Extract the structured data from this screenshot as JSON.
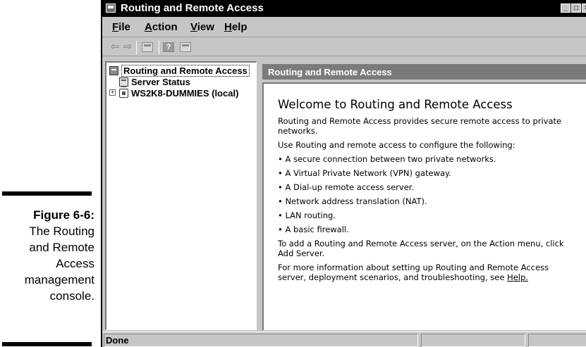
{
  "caption": {
    "figure_number": "Figure 6-6:",
    "text": "The Routing\nand Remote\nAccess\nmanagement\nconsole."
  },
  "window": {
    "title": "Routing and Remote Access",
    "controls": {
      "minimize": "_",
      "maximize": "□",
      "close": "×"
    }
  },
  "menu": [
    {
      "label": "File",
      "access_key": "F",
      "rest": "ile"
    },
    {
      "label": "Action",
      "access_key": "A",
      "rest": "ction"
    },
    {
      "label": "View",
      "access_key": "V",
      "rest": "iew"
    },
    {
      "label": "Help",
      "access_key": "H",
      "rest": "elp"
    }
  ],
  "toolbar": {
    "back_icon": "arrow-left-icon",
    "forward_icon": "arrow-right-icon",
    "help_glyph": "?"
  },
  "tree": {
    "root": "Routing and Remote Access",
    "items": [
      {
        "label": "Server Status"
      },
      {
        "label": "WS2K8-DUMMIES (local)",
        "expander": "+"
      }
    ]
  },
  "details": {
    "header": "Routing and Remote Access",
    "title": "Welcome to Routing and Remote Access",
    "intro": "Routing and Remote Access provides secure remote access to private networks.",
    "lead": "Use Routing and remote access to configure the following:",
    "bullets": [
      "A secure connection between two private networks.",
      "A Virtual Private Network (VPN) gateway.",
      "A Dial-up remote access server.",
      "Network address translation (NAT).",
      "LAN routing.",
      "A basic firewall."
    ],
    "add_server": "To add a Routing and Remote Access server, on the Action menu, click Add Server.",
    "more_info": "For more information about setting up Routing and Remote Access server, deployment scenarios, and troubleshooting, see",
    "help_link": "Help."
  },
  "status": {
    "text": "Done"
  }
}
